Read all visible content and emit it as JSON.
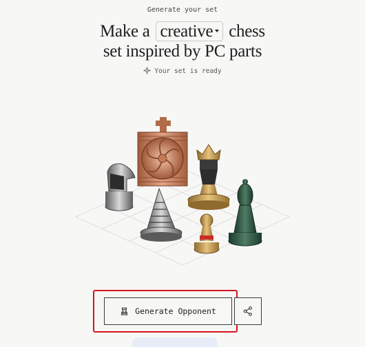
{
  "header": {
    "eyebrow": "Generate your set",
    "headline_before": "Make a",
    "style_value": "creative",
    "headline_after_1": "chess",
    "headline_line2": "set inspired by PC parts",
    "status": "Your set is ready"
  },
  "actions": {
    "generate_label": "Generate Opponent"
  },
  "icons": {
    "status": "sparkle-icon",
    "generate": "chess-piece-icon",
    "share": "share-icon"
  },
  "colors": {
    "highlight": "#d6141b",
    "copper": "#c9825a",
    "gold": "#c59a48",
    "jade": "#2f5a45"
  }
}
